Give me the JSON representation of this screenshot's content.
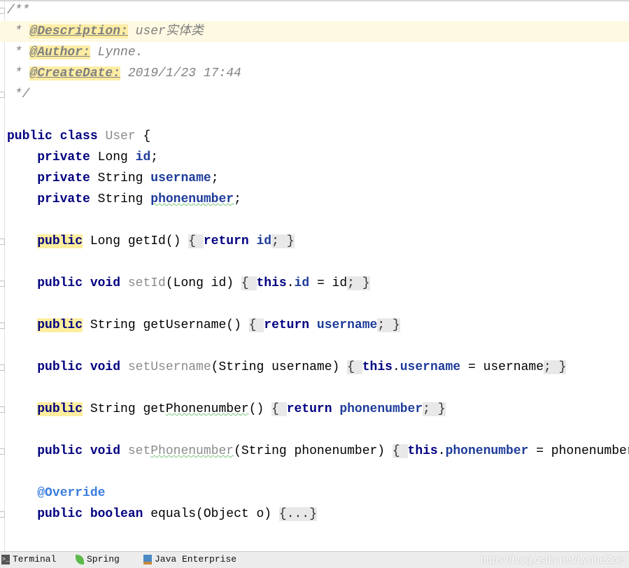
{
  "editor": {
    "lines": [
      [
        [
          "/**",
          "cm"
        ]
      ],
      [
        [
          " * ",
          "cm"
        ],
        [
          "@Description:",
          "tag"
        ],
        [
          " user实体类",
          "cm"
        ]
      ],
      [
        [
          " * ",
          "cm"
        ],
        [
          "@Author:",
          "tag"
        ],
        [
          " Lynne.",
          "cm"
        ]
      ],
      [
        [
          " * ",
          "cm"
        ],
        [
          "@CreateDate:",
          "tag"
        ],
        [
          " 2019/1/23 17:44",
          "cm"
        ]
      ],
      [
        [
          " */",
          "cm"
        ]
      ],
      [],
      [
        [
          "public class ",
          "kw"
        ],
        [
          "User",
          "gray"
        ],
        [
          " {",
          ""
        ]
      ],
      [
        [
          "    ",
          ""
        ],
        [
          "private ",
          "kw"
        ],
        [
          "Long ",
          ""
        ],
        [
          "id",
          "fld"
        ],
        [
          ";",
          ""
        ]
      ],
      [
        [
          "    ",
          ""
        ],
        [
          "private ",
          "kw"
        ],
        [
          "String ",
          ""
        ],
        [
          "username",
          "fld"
        ],
        [
          ";",
          ""
        ]
      ],
      [
        [
          "    ",
          ""
        ],
        [
          "private ",
          "kw"
        ],
        [
          "String ",
          ""
        ],
        [
          "phonenumber",
          "fld typo"
        ],
        [
          ";",
          ""
        ]
      ],
      [],
      [
        [
          "    ",
          ""
        ],
        [
          "public",
          "hlkw"
        ],
        [
          " Long getId() ",
          ""
        ],
        [
          "{ ",
          "fold"
        ],
        [
          "return ",
          "kw"
        ],
        [
          "id",
          "fld"
        ],
        [
          "; }",
          "fold"
        ]
      ],
      [],
      [
        [
          "    ",
          ""
        ],
        [
          "public void ",
          "kw"
        ],
        [
          "setId",
          "gray"
        ],
        [
          "(Long id) ",
          ""
        ],
        [
          "{ ",
          "fold"
        ],
        [
          "this",
          "kw"
        ],
        [
          ".",
          ""
        ],
        [
          "id",
          "fld"
        ],
        [
          " = id",
          ""
        ],
        [
          "; }",
          "fold"
        ]
      ],
      [],
      [
        [
          "    ",
          ""
        ],
        [
          "public",
          "hlkw"
        ],
        [
          " String getUsername() ",
          ""
        ],
        [
          "{ ",
          "fold"
        ],
        [
          "return ",
          "kw"
        ],
        [
          "username",
          "fld"
        ],
        [
          "; }",
          "fold"
        ]
      ],
      [],
      [
        [
          "    ",
          ""
        ],
        [
          "public void ",
          "kw"
        ],
        [
          "setUsername",
          "gray"
        ],
        [
          "(String username) ",
          ""
        ],
        [
          "{ ",
          "fold"
        ],
        [
          "this",
          "kw"
        ],
        [
          ".",
          ""
        ],
        [
          "username",
          "fld"
        ],
        [
          " = username",
          ""
        ],
        [
          "; }",
          "fold"
        ]
      ],
      [],
      [
        [
          "    ",
          ""
        ],
        [
          "public",
          "hlkw"
        ],
        [
          " String get",
          ""
        ],
        [
          "Phonenumber",
          "typo"
        ],
        [
          "() ",
          ""
        ],
        [
          "{ ",
          "fold"
        ],
        [
          "return ",
          "kw"
        ],
        [
          "phonenumber",
          "fld"
        ],
        [
          "; }",
          "fold"
        ]
      ],
      [],
      [
        [
          "    ",
          ""
        ],
        [
          "public void ",
          "kw"
        ],
        [
          "set",
          "gray"
        ],
        [
          "Phonenumber",
          "gray typo"
        ],
        [
          "(String phonenumber) ",
          ""
        ],
        [
          "{ ",
          "fold"
        ],
        [
          "this",
          "kw"
        ],
        [
          ".",
          ""
        ],
        [
          "phonenumber",
          "fld"
        ],
        [
          " = phonenumber",
          ""
        ],
        [
          "; }",
          "fold"
        ]
      ],
      [],
      [
        [
          "    ",
          ""
        ],
        [
          "@Override",
          "ann"
        ]
      ],
      [
        [
          "    ",
          ""
        ],
        [
          "public boolean ",
          "kw"
        ],
        [
          "equals(Object o) ",
          ""
        ],
        [
          "{...}",
          "fold"
        ]
      ]
    ]
  },
  "toolbar": {
    "items": [
      {
        "label": "Terminal",
        "icon": "terminal-icon"
      },
      {
        "label": "Spring",
        "icon": "spring-leaf-icon"
      },
      {
        "label": "Java Enterprise",
        "icon": "java-enterprise-icon"
      }
    ]
  },
  "watermark": "https://blog.csdn.net/LynneZoe",
  "colors": {
    "keyword": "#000080",
    "field": "#1d3b9a",
    "comment": "#808080",
    "annotation": "#3b7de0",
    "caret_line": "#fdf9e3",
    "highlight": "#fcee9e"
  }
}
